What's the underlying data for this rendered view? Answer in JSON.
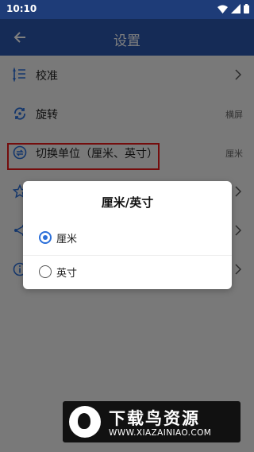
{
  "status_bar": {
    "time": "10:10"
  },
  "app_bar": {
    "title": "设置",
    "back_icon": "arrow-left-icon"
  },
  "settings": {
    "items": [
      {
        "label": "校准",
        "icon": "calibrate-icon",
        "value": "",
        "has_chevron": true
      },
      {
        "label": "旋转",
        "icon": "rotate-icon",
        "value": "横屏",
        "has_chevron": false
      },
      {
        "label": "切换单位（厘米、英寸）",
        "icon": "swap-icon",
        "value": "厘米",
        "has_chevron": false
      },
      {
        "label": "",
        "icon": "star-icon",
        "value": "",
        "has_chevron": true
      },
      {
        "label": "",
        "icon": "share-icon",
        "value": "",
        "has_chevron": true
      },
      {
        "label": "",
        "icon": "info-icon",
        "value": "",
        "has_chevron": true
      }
    ]
  },
  "dialog": {
    "title": "厘米/英寸",
    "options": [
      {
        "label": "厘米",
        "selected": true
      },
      {
        "label": "英寸",
        "selected": false
      }
    ]
  },
  "watermark": {
    "title": "下载鸟资源",
    "url": "WWW.XIAZAINIAO.COM"
  },
  "colors": {
    "app_bar": "#2b57ad",
    "status_bar": "#1e3c78",
    "accent": "#2b6fd9",
    "highlight": "#e81818"
  }
}
